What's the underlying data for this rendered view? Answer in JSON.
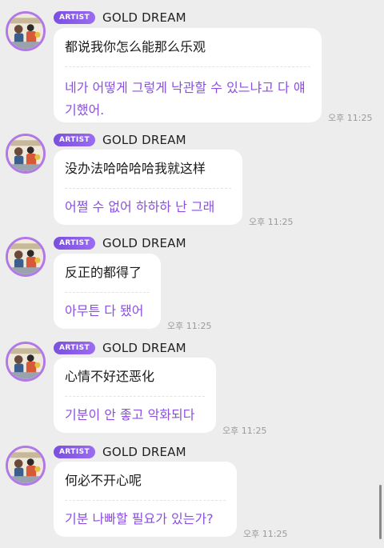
{
  "messages": [
    {
      "badge": "ARTIST",
      "name": "GOLD DREAM",
      "original": "都说我你怎么能那么乐观",
      "translation": "네가 어떻게 그렇게 낙관할 수 있느냐고 다 얘기했어.",
      "time": "오후 11:25"
    },
    {
      "badge": "ARTIST",
      "name": "GOLD DREAM",
      "original": "没办法哈哈哈哈我就这样",
      "translation": "어쩔 수 없어 하하하 난 그래",
      "time": "오후 11:25"
    },
    {
      "badge": "ARTIST",
      "name": "GOLD DREAM",
      "original": "反正的都得了",
      "translation": "아무튼 다 됐어",
      "time": "오후 11:25"
    },
    {
      "badge": "ARTIST",
      "name": "GOLD DREAM",
      "original": "心情不好还恶化",
      "translation": "기분이 안 좋고 악화되다",
      "time": "오후 11:25"
    },
    {
      "badge": "ARTIST",
      "name": "GOLD DREAM",
      "original": "何必不开心呢",
      "translation": "기분 나빠할 필요가 있는가?",
      "time": "오후 11:25"
    }
  ],
  "colors": {
    "background": "#ededed",
    "bubble": "#ffffff",
    "translation_text": "#8a4fe0",
    "badge": "#7a4fe0",
    "avatar_ring": "#b178e8"
  }
}
